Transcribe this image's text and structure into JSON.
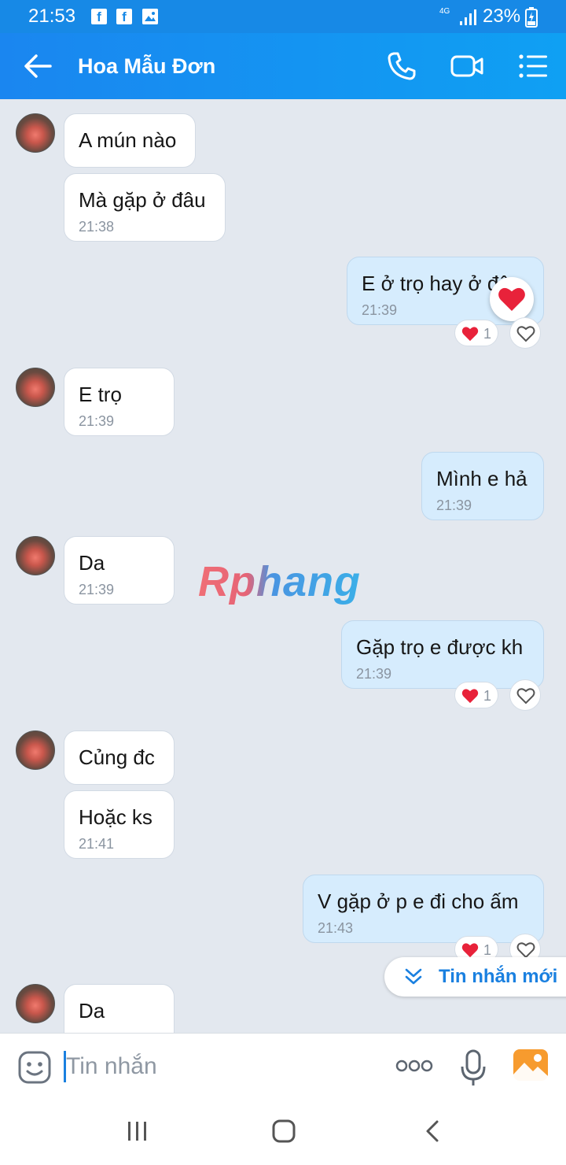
{
  "status_bar": {
    "time": "21:53",
    "network": "4G",
    "battery": "23%",
    "notification_icons": [
      "facebook-icon",
      "facebook-icon",
      "image-icon"
    ]
  },
  "header": {
    "title": "Hoa Mẫu Đơn",
    "accent_color": "#1a86f0",
    "icons": [
      "back-arrow-icon",
      "phone-icon",
      "video-call-icon",
      "menu-list-icon"
    ]
  },
  "messages": [
    {
      "dir": "in",
      "text": "A mún nào",
      "time": ""
    },
    {
      "dir": "in",
      "text": "Mà gặp ở đâu",
      "time": "21:38"
    },
    {
      "dir": "out",
      "text": "E ở trọ hay ở đâu",
      "time": "21:39",
      "reactions": "1"
    },
    {
      "dir": "in",
      "text": "E trọ",
      "time": "21:39"
    },
    {
      "dir": "out",
      "text": "Mình e hả",
      "time": "21:39"
    },
    {
      "dir": "in",
      "text": "Da",
      "time": "21:39"
    },
    {
      "dir": "out",
      "text": "Gặp trọ e được kh",
      "time": "21:39",
      "reactions": "1"
    },
    {
      "dir": "in",
      "text": "Củng đc",
      "time": ""
    },
    {
      "dir": "in",
      "text": "Hoặc ks",
      "time": "21:41"
    },
    {
      "dir": "out",
      "text": "V gặp ở p e đi cho ấm",
      "time": "21:43",
      "reactions": "1"
    },
    {
      "dir": "in",
      "text": "Da",
      "time": ""
    }
  ],
  "watermark": "Rphang",
  "new_message_button": "Tin nhắn mới",
  "composer": {
    "placeholder": "Tin nhắn"
  }
}
